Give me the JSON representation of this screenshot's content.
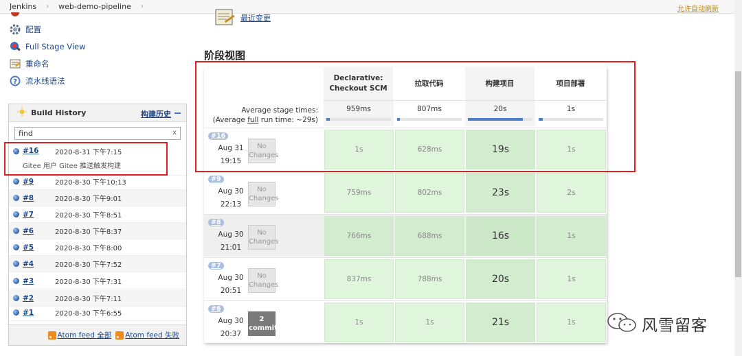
{
  "breadcrumb": {
    "root": "Jenkins",
    "job": "web-demo-pipeline"
  },
  "auto_refresh": "允许自动刷新",
  "tasks": [
    {
      "label": "配置",
      "icon": "gear-icon"
    },
    {
      "label": "Full Stage View",
      "icon": "stage-view-icon"
    },
    {
      "label": "重命名",
      "icon": "rename-icon"
    },
    {
      "label": "流水线语法",
      "icon": "help-icon"
    }
  ],
  "recent_changes": "最近变更",
  "build_history": {
    "title": "Build History",
    "trend": "构建历史",
    "search_value": "find",
    "clear": "x",
    "builds": [
      {
        "num": "#16",
        "date": "2020-8-31 下午7:15",
        "note": "Gitee 用户 Gitee 推送触发构建"
      },
      {
        "num": "#9",
        "date": "2020-8-30 下午10:13"
      },
      {
        "num": "#8",
        "date": "2020-8-30 下午9:01"
      },
      {
        "num": "#7",
        "date": "2020-8-30 下午8:51"
      },
      {
        "num": "#6",
        "date": "2020-8-30 下午8:37"
      },
      {
        "num": "#5",
        "date": "2020-8-30 下午8:00"
      },
      {
        "num": "#4",
        "date": "2020-8-30 下午7:52"
      },
      {
        "num": "#3",
        "date": "2020-8-30 下午7:31"
      },
      {
        "num": "#2",
        "date": "2020-8-30 下午7:11"
      },
      {
        "num": "#1",
        "date": "2020-8-30 下午6:55"
      }
    ],
    "feed_all": "Atom feed 全部",
    "feed_fail": "Atom feed 失败"
  },
  "stage_view": {
    "title": "阶段视图",
    "avg_label_1": "Average stage times:",
    "avg_label_2a": "(Average ",
    "avg_label_2b": "full",
    "avg_label_2c": " run time: ~29s)",
    "stages": [
      {
        "name_1": "Declarative:",
        "name_2": "Checkout SCM",
        "avg": "959ms",
        "avg_fraction": 0.05
      },
      {
        "name_1": "拉取代码",
        "name_2": "",
        "avg": "807ms",
        "avg_fraction": 0.04
      },
      {
        "name_1": "构建项目",
        "name_2": "",
        "avg": "20s",
        "avg_fraction": 0.85
      },
      {
        "name_1": "项目部署",
        "name_2": "",
        "avg": "1s",
        "avg_fraction": 0.06
      }
    ],
    "runs": [
      {
        "badge": "#16",
        "date": "Aug 31",
        "time": "19:15",
        "changes_1": "No",
        "changes_2": "Changes",
        "commits": false,
        "cells": [
          "1s",
          "628ms",
          "19s",
          "1s"
        ]
      },
      {
        "badge": "#9",
        "date": "Aug 30",
        "time": "22:13",
        "changes_1": "No",
        "changes_2": "Changes",
        "commits": false,
        "cells": [
          "759ms",
          "802ms",
          "23s",
          "2s"
        ]
      },
      {
        "badge": "#8",
        "date": "Aug 30",
        "time": "21:01",
        "changes_1": "No",
        "changes_2": "Changes",
        "commits": false,
        "cells": [
          "766ms",
          "688ms",
          "16s",
          "1s"
        ]
      },
      {
        "badge": "#7",
        "date": "Aug 30",
        "time": "20:51",
        "changes_1": "No",
        "changes_2": "Changes",
        "commits": false,
        "cells": [
          "837ms",
          "788ms",
          "20s",
          "1s"
        ]
      },
      {
        "badge": "#6",
        "date": "Aug 30",
        "time": "20:37",
        "changes_1": "2",
        "changes_2": "commits",
        "commits": true,
        "cells": [
          "1s",
          "1s",
          "21s",
          "1s"
        ]
      }
    ]
  },
  "watermark": "风雪留客",
  "colors": {
    "success_cell": "#dff5dc",
    "link": "#204a87",
    "highlight_box": "#e02020",
    "avg_bar": "#4a7ec3"
  }
}
